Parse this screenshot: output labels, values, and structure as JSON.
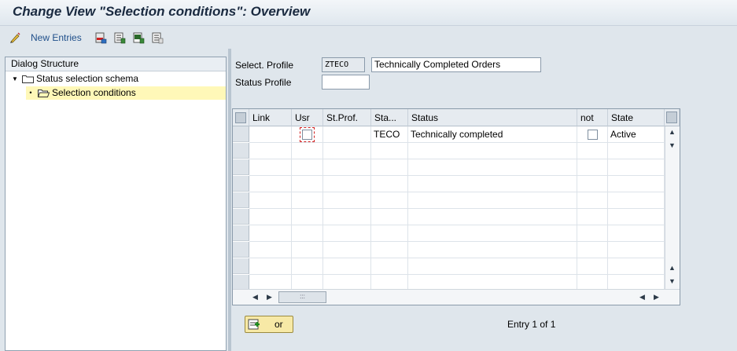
{
  "window": {
    "title": "Change View \"Selection conditions\": Overview"
  },
  "toolbar": {
    "new_entries_label": "New Entries",
    "icons": [
      "edit-glasses-icon",
      "delete-icon",
      "select-all-icon",
      "select-block-icon",
      "deselect-all-icon"
    ]
  },
  "dialog_structure": {
    "header": "Dialog Structure",
    "items": [
      {
        "label": "Status selection schema",
        "expanded": true,
        "level": 0,
        "selected": false
      },
      {
        "label": "Selection conditions",
        "expanded": false,
        "level": 1,
        "selected": true
      }
    ]
  },
  "form": {
    "select_profile_label": "Select. Profile",
    "select_profile_value": "ZTECO",
    "select_profile_desc": "Technically Completed Orders",
    "status_profile_label": "Status Profile",
    "status_profile_value": ""
  },
  "table": {
    "columns": [
      "Link",
      "Usr",
      "St.Prof.",
      "Sta...",
      "Status",
      "not",
      "State"
    ],
    "rows": [
      {
        "link": "",
        "usr": false,
        "st_prof": "",
        "sta": "TECO",
        "status": "Technically completed",
        "not": false,
        "state": "Active"
      }
    ],
    "empty_rows": 9
  },
  "footer": {
    "or_button_label": "or",
    "entry_text": "Entry 1 of 1"
  },
  "colors": {
    "selected_row": "#fff8b8",
    "button_bg": "#f7e9a6",
    "link_blue": "#1f4f8a"
  }
}
